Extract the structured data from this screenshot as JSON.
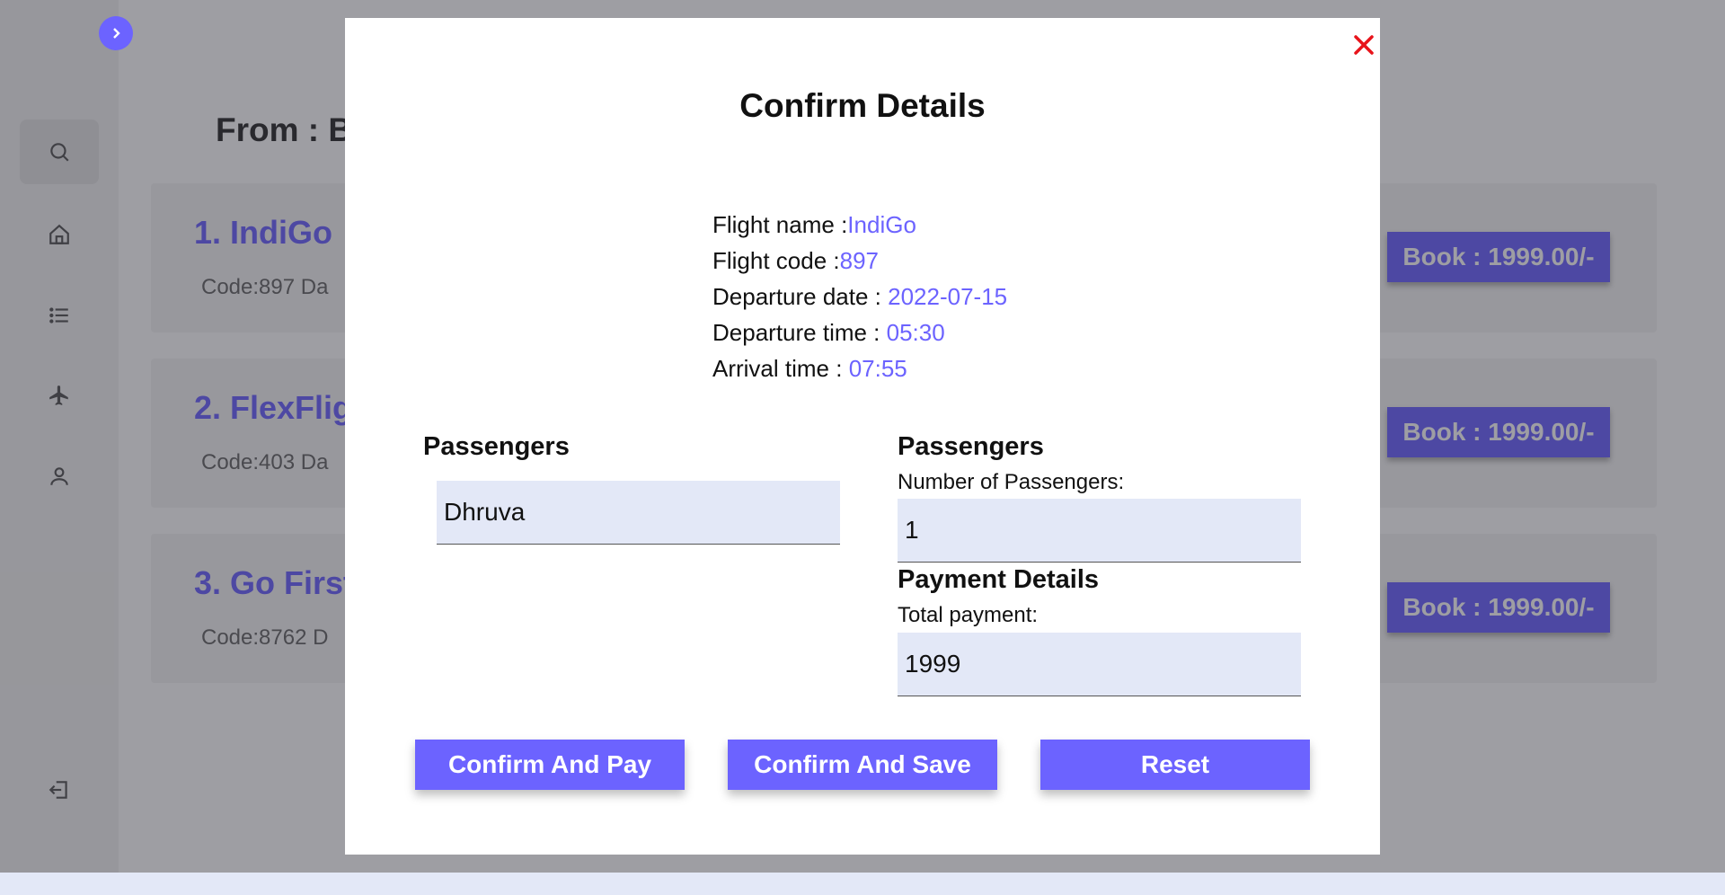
{
  "background": {
    "from_label": "From : B",
    "flights": [
      {
        "title": "1. IndiGo",
        "code": "Code:897    Da",
        "book_label": "Book : 1999.00/-"
      },
      {
        "title": "2. FlexFlig",
        "code": "Code:403    Da",
        "book_label": "Book : 1999.00/-"
      },
      {
        "title": "3. Go First",
        "code": "Code:8762    D",
        "book_label": "Book : 1999.00/-"
      }
    ]
  },
  "sidebar": {
    "icons": [
      "search-icon",
      "home-icon",
      "list-icon",
      "airplane-icon",
      "user-icon",
      "logout-icon"
    ]
  },
  "modal": {
    "title": "Confirm Details",
    "close_icon": "close-icon",
    "flight_info": {
      "name_label": "Flight name :",
      "name_value": "IndiGo",
      "code_label": "Flight code :",
      "code_value": "897",
      "dep_date_label": "Departure date : ",
      "dep_date_value": "2022-07-15",
      "dep_time_label": "Departure time : ",
      "dep_time_value": "05:30",
      "arr_time_label": "Arrival time : ",
      "arr_time_value": "07:55"
    },
    "passengers_left": {
      "heading": "Passengers",
      "name_value": "Dhruva"
    },
    "passengers_right": {
      "heading": "Passengers",
      "count_label": "Number of Passengers:",
      "count_value": "1"
    },
    "payment": {
      "heading": "Payment Details",
      "total_label": "Total payment:",
      "total_value": "1999"
    },
    "buttons": {
      "confirm_pay": "Confirm And Pay",
      "confirm_save": "Confirm And Save",
      "reset": "Reset"
    }
  },
  "colors": {
    "accent": "#6c63ff",
    "close": "#e8141b",
    "field_bg": "#e3e8f7"
  }
}
